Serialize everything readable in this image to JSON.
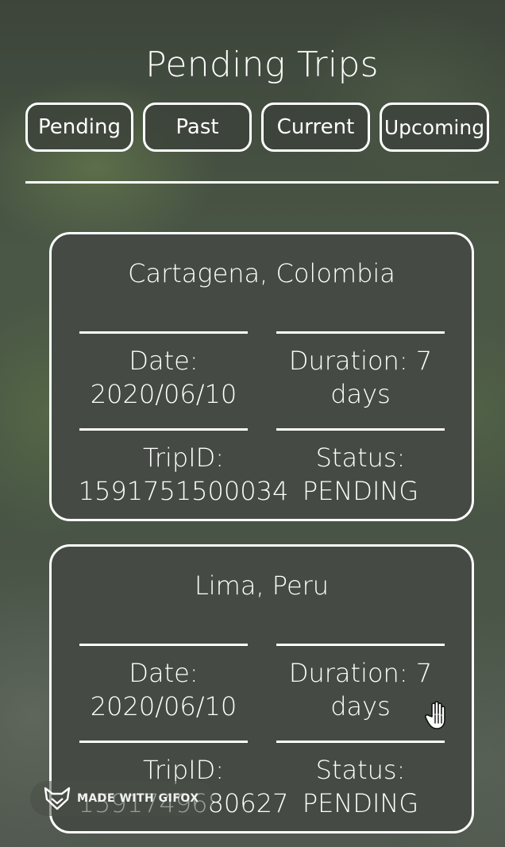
{
  "page": {
    "title": "Pending Trips"
  },
  "tabs": [
    {
      "label": "Pending"
    },
    {
      "label": "Past"
    },
    {
      "label": "Current"
    },
    {
      "label": "Upcoming"
    }
  ],
  "trips": [
    {
      "city": "Cartagena, Colombia",
      "date_label": "Date:",
      "date": "2020/06/10",
      "duration_label": "Duration: 7",
      "duration_unit": "days",
      "tripid_label": "TripID:",
      "tripid": "1591751500034",
      "status_label": "Status:",
      "status": "PENDING"
    },
    {
      "city": "Lima, Peru",
      "date_label": "Date:",
      "date": "2020/06/10",
      "duration_label": "Duration: 7",
      "duration_unit": "days",
      "tripid_label": "TripID:",
      "tripid": "1591749680627",
      "status_label": "Status:",
      "status": "PENDING"
    }
  ],
  "watermark": {
    "text": "MADE WITH GIFOX",
    "icon": "fox-icon"
  },
  "cursor": {
    "icon": "hand-cursor-icon"
  },
  "colors": {
    "background": "#485445",
    "card": "#454b44",
    "border": "#ffffff",
    "text": "#ffffff"
  }
}
